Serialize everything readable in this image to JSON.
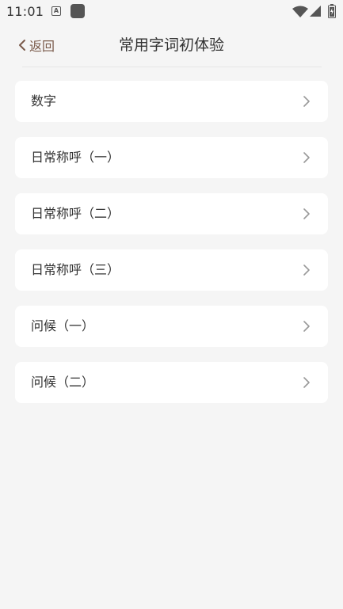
{
  "status_bar": {
    "time": "11:01",
    "a_icon_letter": "A"
  },
  "header": {
    "back_label": "返回",
    "title": "常用字词初体验"
  },
  "list": {
    "items": [
      {
        "label": "数字"
      },
      {
        "label": "日常称呼（一）"
      },
      {
        "label": "日常称呼（二）"
      },
      {
        "label": "日常称呼（三）"
      },
      {
        "label": "问候（一）"
      },
      {
        "label": "问候（二）"
      }
    ]
  },
  "colors": {
    "background": "#f5f5f5",
    "card": "#ffffff",
    "back_accent": "#7a5a4a",
    "chevron": "#999999"
  }
}
